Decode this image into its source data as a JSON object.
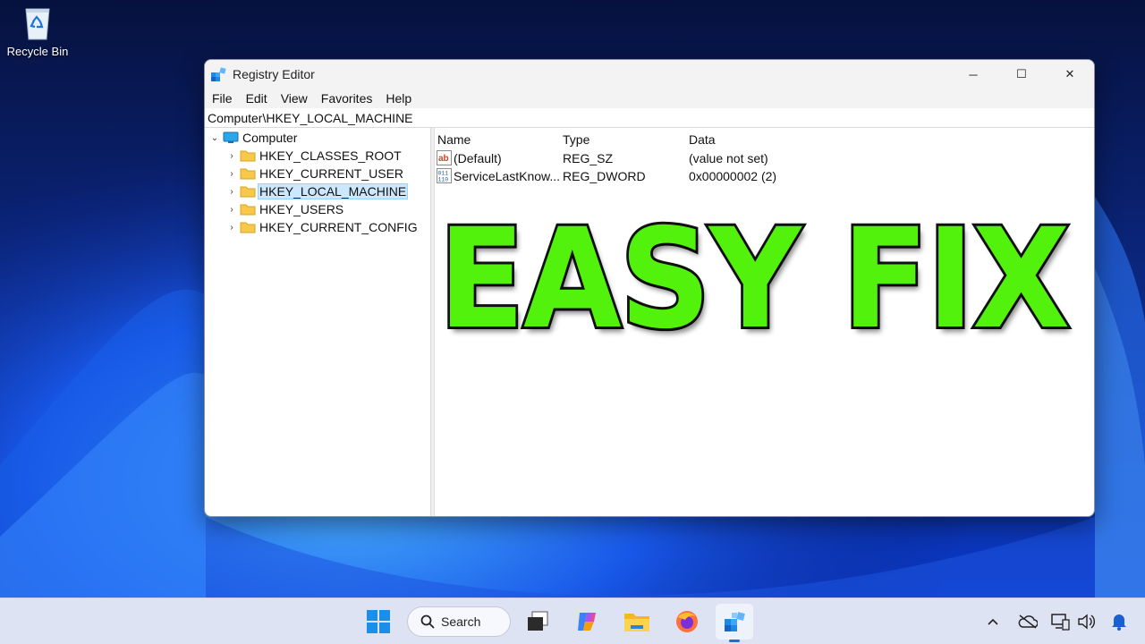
{
  "desktop": {
    "recycle_bin_label": "Recycle Bin"
  },
  "window": {
    "title": "Registry Editor",
    "controls": {
      "minimize": "─",
      "maximize": "☐",
      "close": "✕"
    },
    "menu": [
      "File",
      "Edit",
      "View",
      "Favorites",
      "Help"
    ],
    "address": "Computer\\HKEY_LOCAL_MACHINE"
  },
  "tree": {
    "root": {
      "label": "Computer",
      "expanded": true
    },
    "children": [
      {
        "label": "HKEY_CLASSES_ROOT",
        "selected": false
      },
      {
        "label": "HKEY_CURRENT_USER",
        "selected": false
      },
      {
        "label": "HKEY_LOCAL_MACHINE",
        "selected": true
      },
      {
        "label": "HKEY_USERS",
        "selected": false
      },
      {
        "label": "HKEY_CURRENT_CONFIG",
        "selected": false
      }
    ]
  },
  "values": {
    "columns": [
      "Name",
      "Type",
      "Data"
    ],
    "rows": [
      {
        "name": "(Default)",
        "type": "REG_SZ",
        "data": "(value not set)",
        "icon": "string-value-icon"
      },
      {
        "name": "ServiceLastKnow...",
        "type": "REG_DWORD",
        "data": "0x00000002 (2)",
        "icon": "binary-value-icon"
      }
    ]
  },
  "overlay": {
    "text": "EASY FIX",
    "color": "#52f20c"
  },
  "taskbar": {
    "search_label": "Search",
    "pinned": [
      "windows-start-icon",
      "task-view-icon",
      "copilot-icon",
      "file-explorer-icon",
      "firefox-icon",
      "registry-editor-icon"
    ],
    "active_app": "registry-editor-icon",
    "tray": [
      "chevron-up-icon",
      "onedrive-offline-icon",
      "network-icon",
      "volume-icon",
      "notification-bell-icon"
    ]
  },
  "colors": {
    "selection_bg": "#cce8ff",
    "accent": "#1a6fd4",
    "taskbar_bg": "#dde3f3"
  }
}
